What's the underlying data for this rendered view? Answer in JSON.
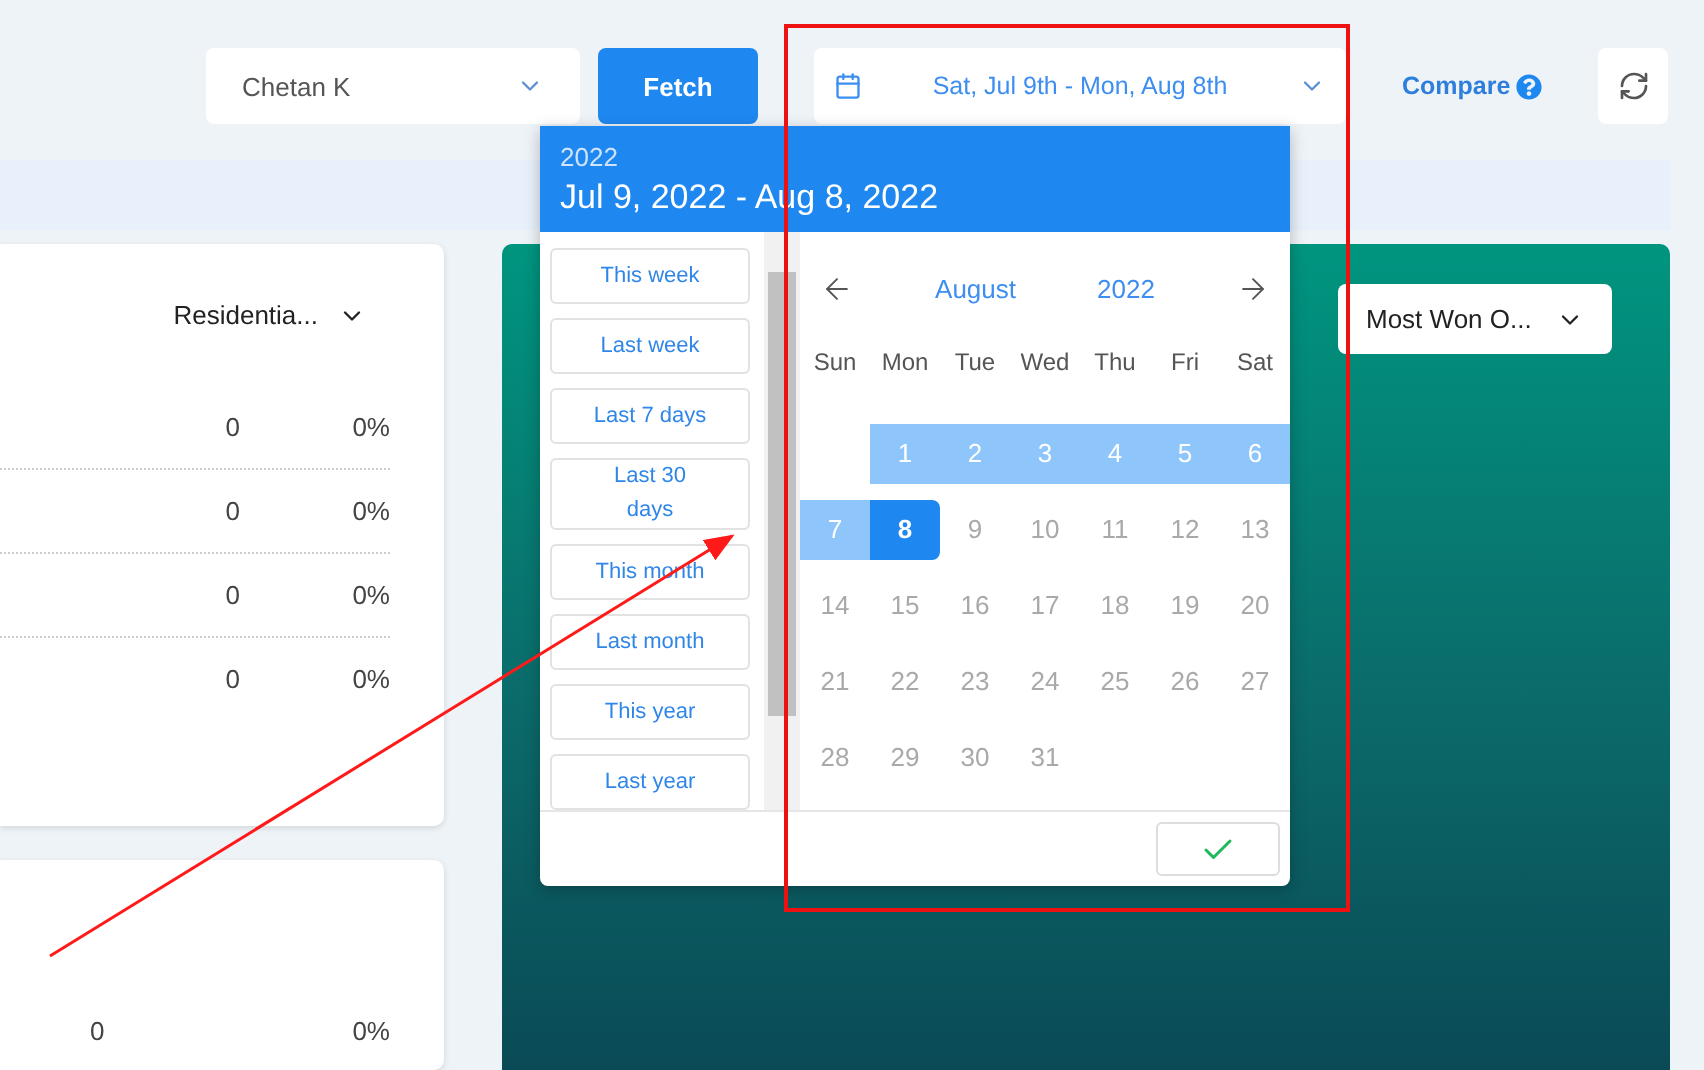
{
  "toolbar": {
    "user_select": {
      "value": "Chetan K"
    },
    "fetch_button": "Fetch",
    "date_range": {
      "value": "Sat, Jul 9th - Mon, Aug 8th"
    },
    "compare_link": "Compare"
  },
  "left_card": {
    "filter": "Residentia...",
    "rows": [
      {
        "count": "0",
        "percent": "0%"
      },
      {
        "count": "0",
        "percent": "0%"
      },
      {
        "count": "0",
        "percent": "0%"
      },
      {
        "count": "0",
        "percent": "0%"
      }
    ]
  },
  "bottom_card": {
    "rows": [
      {
        "count": "0",
        "percent": "0%"
      }
    ]
  },
  "chart_panel": {
    "dropdown": "Most Won O..."
  },
  "date_picker": {
    "year": "2022",
    "range": "Jul 9, 2022 - Aug 8, 2022",
    "presets": [
      "This week",
      "Last week",
      "Last 7 days",
      "Last 30 days",
      "This month",
      "Last month",
      "This year",
      "Last year"
    ],
    "month": "August",
    "calendar_year": "2022",
    "weekdays": [
      "Sun",
      "Mon",
      "Tue",
      "Wed",
      "Thu",
      "Fri",
      "Sat"
    ],
    "days": [
      {
        "kind": "blank"
      },
      {
        "label": "1",
        "kind": "in_range"
      },
      {
        "label": "2",
        "kind": "in_range"
      },
      {
        "label": "3",
        "kind": "in_range"
      },
      {
        "label": "4",
        "kind": "in_range"
      },
      {
        "label": "5",
        "kind": "in_range"
      },
      {
        "label": "6",
        "kind": "in_range"
      },
      {
        "label": "7",
        "kind": "in_range"
      },
      {
        "label": "8",
        "kind": "selected"
      },
      {
        "label": "9",
        "kind": "disabled"
      },
      {
        "label": "10",
        "kind": "disabled"
      },
      {
        "label": "11",
        "kind": "disabled"
      },
      {
        "label": "12",
        "kind": "disabled"
      },
      {
        "label": "13",
        "kind": "disabled"
      },
      {
        "label": "14",
        "kind": "disabled"
      },
      {
        "label": "15",
        "kind": "disabled"
      },
      {
        "label": "16",
        "kind": "disabled"
      },
      {
        "label": "17",
        "kind": "disabled"
      },
      {
        "label": "18",
        "kind": "disabled"
      },
      {
        "label": "19",
        "kind": "disabled"
      },
      {
        "label": "20",
        "kind": "disabled"
      },
      {
        "label": "21",
        "kind": "disabled"
      },
      {
        "label": "22",
        "kind": "disabled"
      },
      {
        "label": "23",
        "kind": "disabled"
      },
      {
        "label": "24",
        "kind": "disabled"
      },
      {
        "label": "25",
        "kind": "disabled"
      },
      {
        "label": "26",
        "kind": "disabled"
      },
      {
        "label": "27",
        "kind": "disabled"
      },
      {
        "label": "28",
        "kind": "disabled"
      },
      {
        "label": "29",
        "kind": "disabled"
      },
      {
        "label": "30",
        "kind": "disabled"
      },
      {
        "label": "31",
        "kind": "disabled"
      }
    ]
  }
}
